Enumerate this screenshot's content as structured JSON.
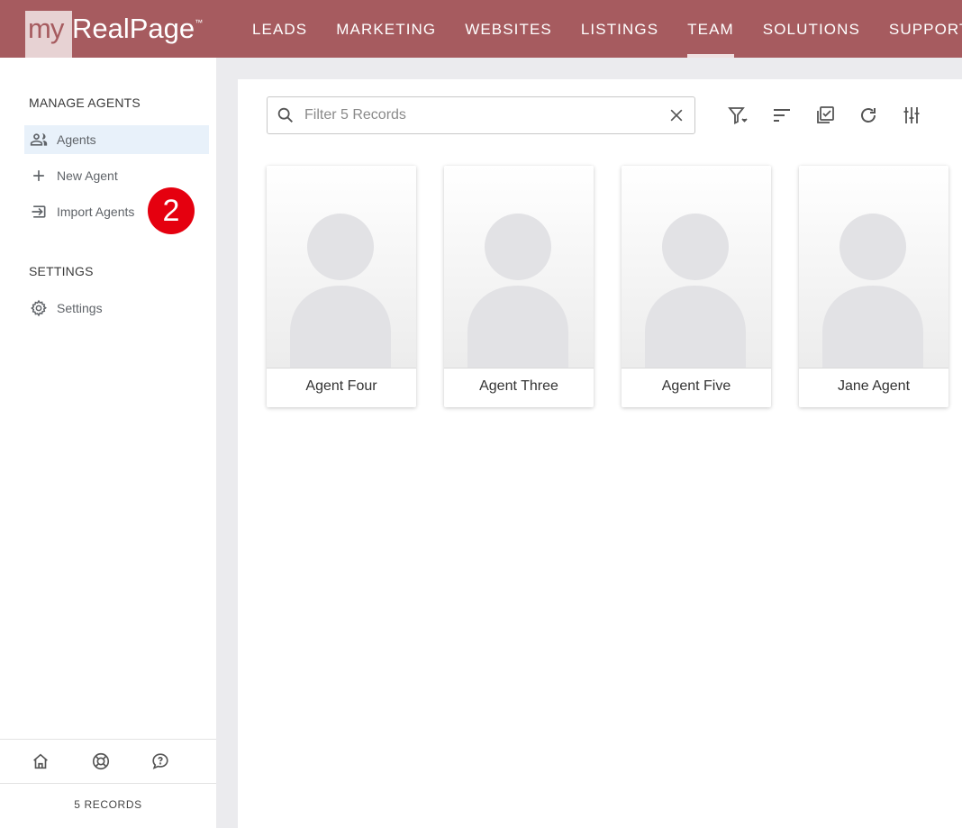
{
  "brand": {
    "logo_prefix": "my",
    "logo_name": "RealPage",
    "logo_tm": "™"
  },
  "nav": [
    {
      "label": "LEADS",
      "active": false
    },
    {
      "label": "MARKETING",
      "active": false
    },
    {
      "label": "WEBSITES",
      "active": false
    },
    {
      "label": "LISTINGS",
      "active": false
    },
    {
      "label": "TEAM",
      "active": true
    },
    {
      "label": "SOLUTIONS",
      "active": false
    },
    {
      "label": "SUPPORT",
      "active": false
    }
  ],
  "sidebar": {
    "manage_heading": "MANAGE AGENTS",
    "manage_items": [
      {
        "label": "Agents",
        "icon": "people-icon",
        "active": true
      },
      {
        "label": "New Agent",
        "icon": "plus-icon",
        "active": false
      },
      {
        "label": "Import Agents",
        "icon": "import-icon",
        "active": false
      }
    ],
    "step_badge": "2",
    "settings_heading": "SETTINGS",
    "settings_items": [
      {
        "label": "Settings",
        "icon": "gear-icon"
      }
    ],
    "footer_icons": [
      "home-icon",
      "lifebuoy-icon",
      "help-chat-icon"
    ],
    "records_label": "5 RECORDS"
  },
  "search": {
    "placeholder": "Filter 5 Records",
    "value": ""
  },
  "toolbar": [
    "filter-icon",
    "sort-icon",
    "select-all-icon",
    "refresh-icon",
    "columns-settings-icon"
  ],
  "agents": [
    {
      "name": "Agent Four"
    },
    {
      "name": "Agent Three"
    },
    {
      "name": "Agent Five"
    },
    {
      "name": "Jane Agent"
    }
  ],
  "colors": {
    "header": "#a65b5f",
    "active_item_bg": "#e8f1fa",
    "badge": "#e5000f"
  }
}
